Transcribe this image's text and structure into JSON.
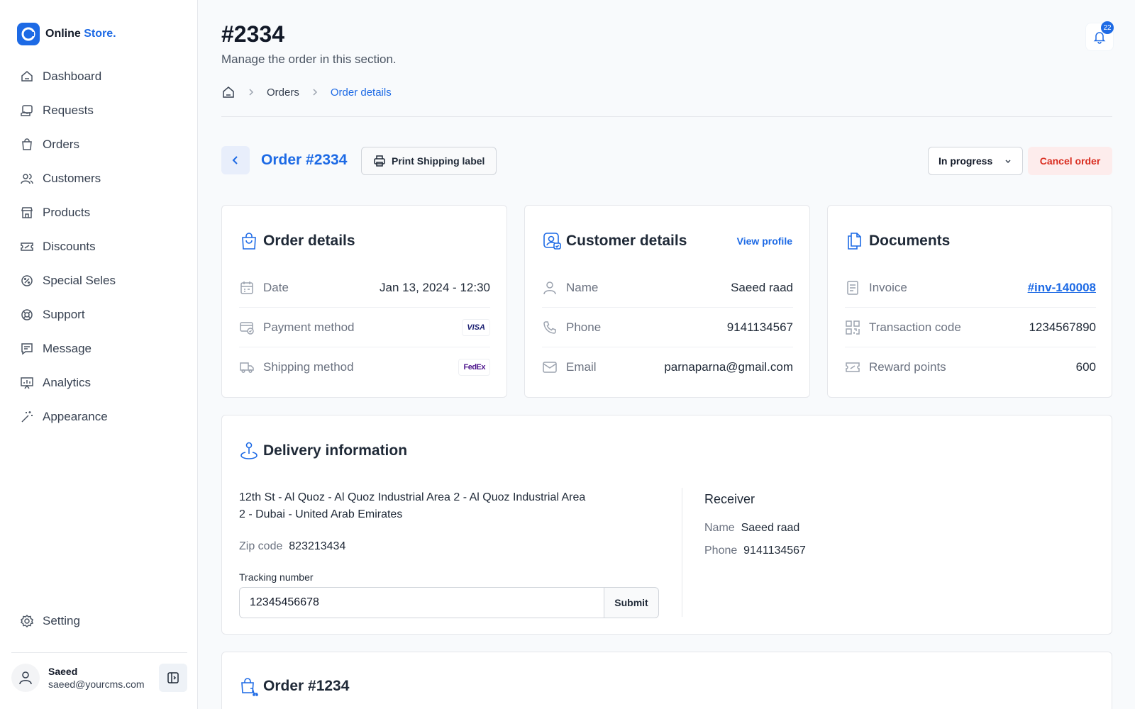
{
  "brand": {
    "name": "Online",
    "accent": "Store."
  },
  "nav": [
    {
      "label": "Dashboard",
      "icon": "home-icon"
    },
    {
      "label": "Requests",
      "icon": "requests-icon"
    },
    {
      "label": "Orders",
      "icon": "bag-icon"
    },
    {
      "label": "Customers",
      "icon": "users-icon"
    },
    {
      "label": "Products",
      "icon": "store-icon"
    },
    {
      "label": "Discounts",
      "icon": "ticket-icon"
    },
    {
      "label": "Special Seles",
      "icon": "badge-icon"
    },
    {
      "label": "Support",
      "icon": "lifebuoy-icon"
    },
    {
      "label": "Message",
      "icon": "message-icon"
    },
    {
      "label": "Analytics",
      "icon": "chart-icon"
    },
    {
      "label": "Appearance",
      "icon": "wand-icon"
    }
  ],
  "setting_label": "Setting",
  "user": {
    "name": "Saeed",
    "email": "saeed@yourcms.com"
  },
  "header": {
    "title": "#2334",
    "subtitle": "Manage the order in this section.",
    "notification_count": "22"
  },
  "breadcrumb": {
    "orders": "Orders",
    "current": "Order details"
  },
  "toolbar": {
    "order_title": "Order #2334",
    "print_label": "Print Shipping label",
    "status": "In progress",
    "cancel_label": "Cancel order"
  },
  "order_details": {
    "title": "Order details",
    "date_label": "Date",
    "date_value": "Jan 13, 2024 - 12:30",
    "payment_label": "Payment method",
    "payment_value": "VISA",
    "shipping_label": "Shipping method",
    "shipping_value": "FedEx"
  },
  "customer_details": {
    "title": "Customer details",
    "link": "View profile",
    "name_label": "Name",
    "name_value": "Saeed raad",
    "phone_label": "Phone",
    "phone_value": "9141134567",
    "email_label": "Email",
    "email_value": "parnaparna@gmail.com"
  },
  "documents": {
    "title": "Documents",
    "invoice_label": "Invoice",
    "invoice_value": "#inv-140008",
    "transaction_label": "Transaction code",
    "transaction_value": "1234567890",
    "reward_label": "Reward points",
    "reward_value": "600"
  },
  "delivery": {
    "title": "Delivery information",
    "address_line1": "12th St - Al Quoz - Al Quoz Industrial Area 2 - Al Quoz Industrial Area",
    "address_line2": "2 - Dubai - United Arab Emirates",
    "zip_label": "Zip code",
    "zip_value": "823213434",
    "tracking_label": "Tracking number",
    "tracking_value": "12345456678",
    "submit_label": "Submit",
    "receiver_title": "Receiver",
    "receiver_name_label": "Name",
    "receiver_name": "Saeed raad",
    "receiver_phone_label": "Phone",
    "receiver_phone": "9141134567"
  },
  "next_order": {
    "title": "Order #1234"
  },
  "colors": {
    "accent": "#1d6ae5",
    "danger": "#d92d20"
  }
}
